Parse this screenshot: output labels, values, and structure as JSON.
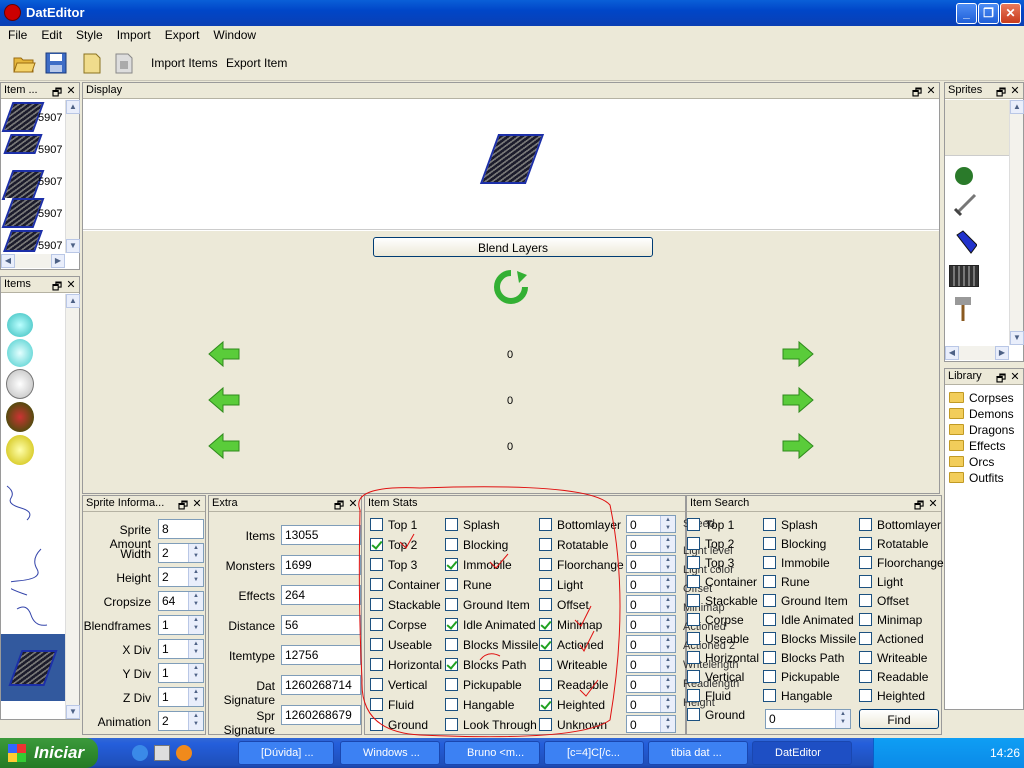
{
  "window": {
    "title": "DatEditor",
    "minimize": "_",
    "maximize": "❐",
    "close": "✕"
  },
  "menu": [
    "File",
    "Edit",
    "Style",
    "Import",
    "Export",
    "Window"
  ],
  "toolbar": {
    "import_items": "Import Items",
    "export_item": "Export Item"
  },
  "item_panel": {
    "title": "Item ...",
    "ids": [
      "5907",
      "5907",
      "5907",
      "5907",
      "5907"
    ]
  },
  "items_panel": {
    "title": "Items"
  },
  "display_panel": {
    "title": "Display",
    "blend_button": "Blend Layers",
    "values": [
      "0",
      "0",
      "0"
    ]
  },
  "sprites_panel": {
    "title": "Sprites"
  },
  "library_panel": {
    "title": "Library",
    "folders": [
      "Corpses",
      "Demons",
      "Dragons",
      "Effects",
      "Orcs",
      "Outfits"
    ]
  },
  "sprite_info": {
    "title": "Sprite Informa...",
    "fields": [
      {
        "label": "Sprite Amount",
        "value": "8",
        "type": "text"
      },
      {
        "label": "Width",
        "value": "2",
        "type": "spin"
      },
      {
        "label": "Height",
        "value": "2",
        "type": "spin"
      },
      {
        "label": "Cropsize",
        "value": "64",
        "type": "spin"
      },
      {
        "label": "Blendframes",
        "value": "1",
        "type": "spin"
      },
      {
        "label": "X Div",
        "value": "1",
        "type": "spin"
      },
      {
        "label": "Y Div",
        "value": "1",
        "type": "spin"
      },
      {
        "label": "Z Div",
        "value": "1",
        "type": "spin"
      },
      {
        "label": "Animation",
        "value": "2",
        "type": "spin"
      }
    ]
  },
  "extra": {
    "title": "Extra",
    "fields": [
      {
        "label": "Items",
        "value": "13055"
      },
      {
        "label": "Monsters",
        "value": "1699"
      },
      {
        "label": "Effects",
        "value": "264"
      },
      {
        "label": "Distance",
        "value": "56"
      },
      {
        "label": "Itemtype",
        "value": "12756"
      },
      {
        "label": "Dat Signature",
        "value": "1260268714"
      },
      {
        "label": "Spr Signature",
        "value": "1260268679"
      }
    ]
  },
  "item_stats": {
    "title": "Item Stats",
    "col1": [
      {
        "label": "Top 1",
        "checked": false
      },
      {
        "label": "Top 2",
        "checked": true
      },
      {
        "label": "Top 3",
        "checked": false
      },
      {
        "label": "Container",
        "checked": false
      },
      {
        "label": "Stackable",
        "checked": false
      },
      {
        "label": "Corpse",
        "checked": false
      },
      {
        "label": "Useable",
        "checked": false
      },
      {
        "label": "Horizontal",
        "checked": false
      },
      {
        "label": "Vertical",
        "checked": false
      },
      {
        "label": "Fluid",
        "checked": false
      },
      {
        "label": "Ground",
        "checked": false
      }
    ],
    "col2": [
      {
        "label": "Splash",
        "checked": false
      },
      {
        "label": "Blocking",
        "checked": false
      },
      {
        "label": "Immobile",
        "checked": true
      },
      {
        "label": "Rune",
        "checked": false
      },
      {
        "label": "Ground Item",
        "checked": false
      },
      {
        "label": "Idle Animated",
        "checked": true
      },
      {
        "label": "Blocks Missile",
        "checked": false
      },
      {
        "label": "Blocks Path",
        "checked": true
      },
      {
        "label": "Pickupable",
        "checked": false
      },
      {
        "label": "Hangable",
        "checked": false
      },
      {
        "label": "Look Through",
        "checked": false
      }
    ],
    "col3": [
      {
        "label": "Bottomlayer",
        "checked": false
      },
      {
        "label": "Rotatable",
        "checked": false
      },
      {
        "label": "Floorchange",
        "checked": false
      },
      {
        "label": "Light",
        "checked": false
      },
      {
        "label": "Offset",
        "checked": false
      },
      {
        "label": "Minimap",
        "checked": true
      },
      {
        "label": "Actioned",
        "checked": true
      },
      {
        "label": "Writeable",
        "checked": false
      },
      {
        "label": "Readable",
        "checked": false
      },
      {
        "label": "Heighted",
        "checked": true
      },
      {
        "label": "Unknown",
        "checked": false
      }
    ],
    "spinners": [
      "0",
      "0",
      "0",
      "0",
      "0",
      "0",
      "0",
      "0",
      "0",
      "0",
      "0"
    ]
  },
  "item_search": {
    "title": "Item Search",
    "under_labels": [
      "Speed",
      "Light level",
      "Light color",
      "Offset",
      "Minimap",
      "Actioned",
      "Actioned 2",
      "Writelength",
      "Readlength",
      "Height"
    ],
    "col1": [
      "Top 1",
      "Top 2",
      "Top 3",
      "Container",
      "Stackable",
      "Corpse",
      "Useable",
      "Horizontal",
      "Vertical",
      "Fluid",
      "Ground"
    ],
    "col2": [
      "Splash",
      "Blocking",
      "Immobile",
      "Rune",
      "Ground Item",
      "Idle Animated",
      "Blocks Missile",
      "Blocks Path",
      "Pickupable",
      "Hangable"
    ],
    "col3": [
      "Bottomlayer",
      "Rotatable",
      "Floorchange",
      "Light",
      "Offset",
      "Minimap",
      "Actioned",
      "Writeable",
      "Readable",
      "Heighted"
    ],
    "spin_value": "0",
    "find_button": "Find"
  },
  "taskbar": {
    "start": "Iniciar",
    "tasks": [
      "[Dúvida] ...",
      "Windows ...",
      "Bruno <m...",
      "[c=4]C[/c...",
      "tibia dat ...",
      "DatEditor"
    ],
    "clock": "14:26"
  }
}
